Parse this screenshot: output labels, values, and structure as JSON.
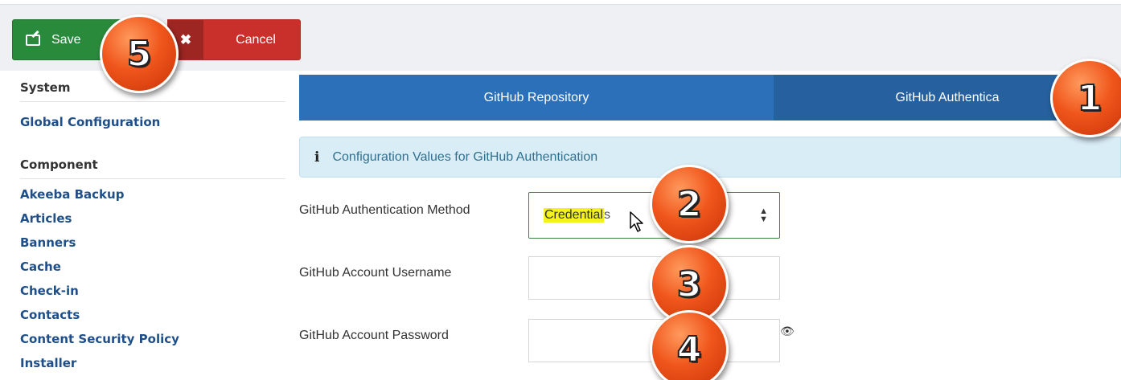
{
  "toolbar": {
    "save_label": "Save",
    "cancel_label": "Cancel",
    "cancel_icon_glyph": "✖"
  },
  "sidebar": {
    "system_heading": "System",
    "system_items": [
      "Global Configuration"
    ],
    "component_heading": "Component",
    "component_items": [
      "Akeeba Backup",
      "Articles",
      "Banners",
      "Cache",
      "Check-in",
      "Contacts",
      "Content Security Policy",
      "Installer"
    ]
  },
  "tabs": [
    "GitHub Repository",
    "GitHub Authentica"
  ],
  "info": {
    "icon": "info-icon",
    "icon_glyph": "i",
    "text": "Configuration Values for GitHub Authentication"
  },
  "form": {
    "auth_method_label": "GitHub Authentication Method",
    "auth_method_value_highlighted": "Credential",
    "auth_method_value_rest": "s",
    "username_label": "GitHub Account Username",
    "username_value": "",
    "password_label": "GitHub Account Password",
    "password_value": "",
    "eye_glyph": "👁"
  },
  "annotations": [
    "1",
    "2",
    "3",
    "4",
    "5"
  ],
  "colors": {
    "save": "#2a8a3c",
    "cancel": "#c9302c",
    "tab_active": "#2c70b9",
    "info_bg": "#d9edf7",
    "badge": "#f0561b",
    "highlight": "#f4f21e"
  }
}
